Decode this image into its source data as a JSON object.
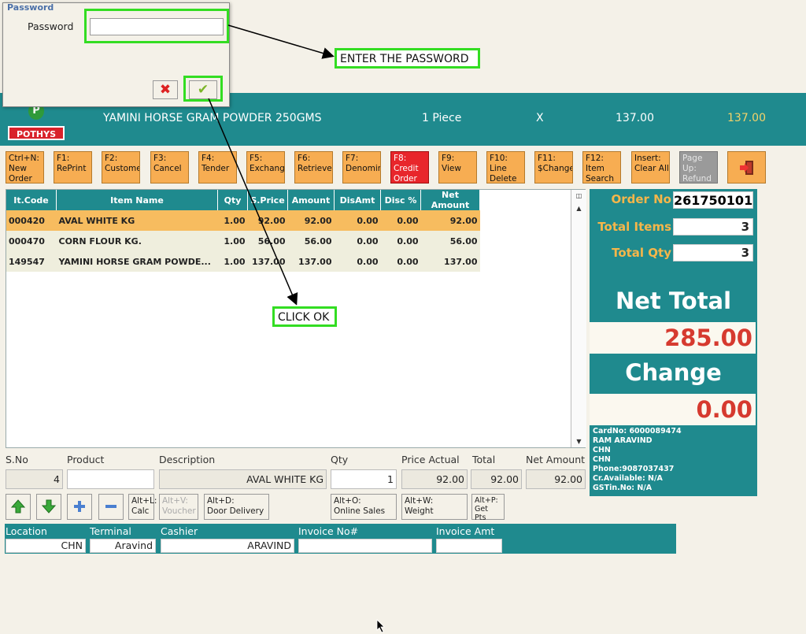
{
  "dialog": {
    "title": "Password",
    "password_label": "Password",
    "password_value": ""
  },
  "annotations": {
    "enter_password": "ENTER THE PASSWORD",
    "click_ok": "CLICK OK"
  },
  "header": {
    "brand": "POTHYS",
    "item_name": "YAMINI HORSE GRAM  POWDER 250GMS",
    "unit": "1 Piece",
    "multiplier": "X",
    "price": "137.00",
    "total": "137.00"
  },
  "fkeys": [
    {
      "l1": "Ctrl+N:",
      "l2": "New",
      "l3": "Order"
    },
    {
      "l1": "F1:",
      "l2": "RePrint",
      "l3": ""
    },
    {
      "l1": "F2:",
      "l2": "Custome",
      "l3": ""
    },
    {
      "l1": "F3:",
      "l2": "Cancel",
      "l3": ""
    },
    {
      "l1": "F4:",
      "l2": "Tender",
      "l3": ""
    },
    {
      "l1": "F5:",
      "l2": "Exchang",
      "l3": ""
    },
    {
      "l1": "F6:",
      "l2": "Retrieve",
      "l3": ""
    },
    {
      "l1": "F7:",
      "l2": "Denomin",
      "l3": ""
    },
    {
      "l1": "F8:",
      "l2": "Credit",
      "l3": "Order"
    },
    {
      "l1": "F9:",
      "l2": "View",
      "l3": ""
    },
    {
      "l1": "F10:",
      "l2": "Line",
      "l3": "Delete"
    },
    {
      "l1": "F11:",
      "l2": "$Change",
      "l3": ""
    },
    {
      "l1": "F12:",
      "l2": "Item",
      "l3": "Search"
    },
    {
      "l1": "Insert:",
      "l2": "Clear All",
      "l3": ""
    },
    {
      "l1": "Page",
      "l2": "Up:",
      "l3": "Refund"
    }
  ],
  "grid": {
    "columns": [
      "It.Code",
      "Item Name",
      "Qty",
      "S.Price",
      "Amount",
      "DisAmt",
      "Disc %",
      "Net Amount"
    ],
    "rows": [
      [
        "000420",
        "AVAL WHITE  KG",
        "1.00",
        "92.00",
        "92.00",
        "0.00",
        "0.00",
        "92.00"
      ],
      [
        "000470",
        "CORN FLOUR KG.",
        "1.00",
        "56.00",
        "56.00",
        "0.00",
        "0.00",
        "56.00"
      ],
      [
        "149547",
        "YAMINI HORSE GRAM  POWDE...",
        "1.00",
        "137.00",
        "137.00",
        "0.00",
        "0.00",
        "137.00"
      ]
    ]
  },
  "summary": {
    "order_no_label": "Order No",
    "order_no": "261750101",
    "total_items_label": "Total Items",
    "total_items": "3",
    "total_qty_label": "Total Qty",
    "total_qty": "3",
    "net_total_label": "Net Total",
    "net_total": "285.00",
    "change_label": "Change",
    "change": "0.00",
    "customer": [
      "CardNo: 6000089474",
      "RAM ARAVIND",
      "CHN",
      "CHN",
      "Phone:9087037437",
      "Cr.Available: N/A",
      "GSTin.No: N/A"
    ]
  },
  "entry": {
    "sno_label": "S.No",
    "sno": "4",
    "product_label": "Product",
    "product": "",
    "description_label": "Description",
    "description": "AVAL WHITE  KG",
    "qty_label": "Qty",
    "qty": "1",
    "price_actual_label": "Price Actual",
    "price_actual": "92.00",
    "total_label": "Total",
    "total": "92.00",
    "net_amount_label": "Net Amount",
    "net_amount": "92.00"
  },
  "options": {
    "calc": {
      "l1": "Alt+L:",
      "l2": "Calc"
    },
    "voucher": {
      "l1": "Alt+V:",
      "l2": "Voucher"
    },
    "door_delivery": {
      "l1": "Alt+D:",
      "l2": "Door Delivery"
    },
    "online_sales": {
      "l1": "Alt+O:",
      "l2": "Online Sales"
    },
    "weight": {
      "l1": "Alt+W:",
      "l2": "Weight"
    },
    "get_pts": {
      "l1": "Alt+P:",
      "l2": "Get",
      "l3": "Pts"
    }
  },
  "status": {
    "location_label": "Location",
    "location": "CHN",
    "terminal_label": "Terminal",
    "terminal": "Aravind",
    "cashier_label": "Cashier",
    "cashier": "ARAVIND",
    "invoice_no_label": "Invoice No#",
    "invoice_no": "",
    "invoice_amt_label": "Invoice Amt",
    "invoice_amt": ""
  },
  "colors": {
    "teal": "#1f8a8e",
    "orange": "#f7ad52",
    "red": "#e8262b",
    "highlight": "#33dd22",
    "accent_value": "#d63a2f"
  }
}
